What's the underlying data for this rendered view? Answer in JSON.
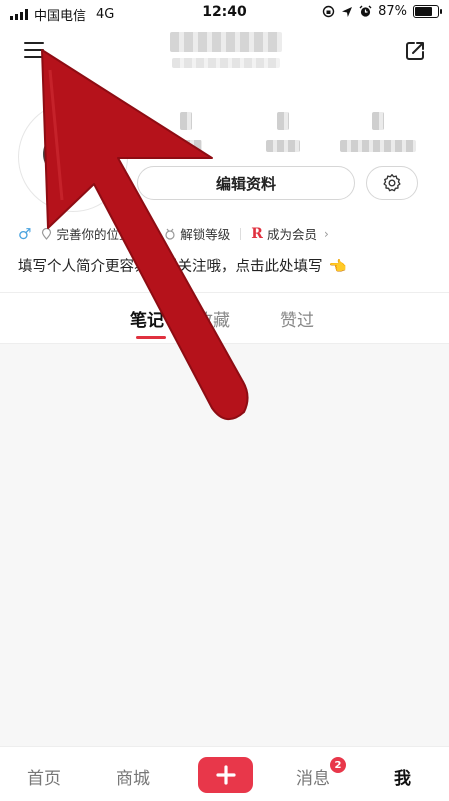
{
  "status_bar": {
    "carrier": "中国电信",
    "network": "4G",
    "time": "12:40",
    "battery_percent": "87%",
    "battery_level": 0.87,
    "icons": [
      "signal-icon",
      "rotation-lock-icon",
      "location-icon",
      "alarm-icon",
      "battery-icon"
    ]
  },
  "header": {
    "menu_icon": "menu-icon",
    "share_icon": "share-icon"
  },
  "profile": {
    "edit_label": "编辑资料",
    "settings_icon": "gear-icon"
  },
  "tags": {
    "gender_icon": "male-icon",
    "location": "完善你的位置",
    "level": "解锁等级",
    "member": "成为会员",
    "member_icon_text": "R"
  },
  "bio": {
    "text": "填写个人简介更容易获得关注哦，点击此处填写"
  },
  "tabs": [
    {
      "label": "笔记",
      "active": true
    },
    {
      "label": "收藏",
      "active": false
    },
    {
      "label": "赞过",
      "active": false
    }
  ],
  "bottom_nav": {
    "home": "首页",
    "mall": "商城",
    "add_icon": "plus-icon",
    "messages": "消息",
    "messages_badge": "2",
    "me": "我"
  },
  "colors": {
    "accent": "#e8374a",
    "arrow": "#b5121b",
    "male": "#4aa3df"
  }
}
